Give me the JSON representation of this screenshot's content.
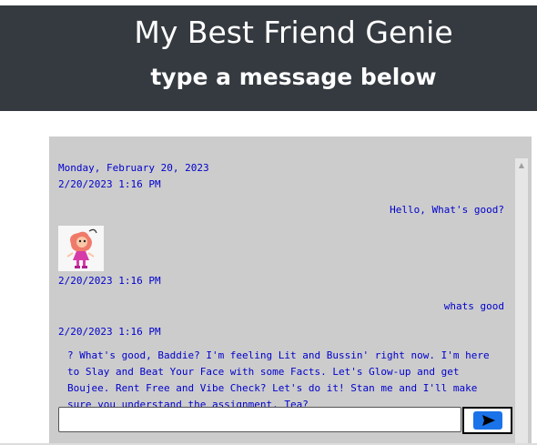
{
  "header": {
    "title": "My Best Friend Genie",
    "subtitle": "type a message below"
  },
  "chat": {
    "date_line": "Monday, February 20, 2023",
    "timestamp_1": "2/20/2023 1:16 PM",
    "user_message_1": "Hello, What's good?",
    "timestamp_2": "2/20/2023 1:16 PM",
    "user_message_2": "whats good",
    "timestamp_3": "2/20/2023 1:16 PM",
    "bot_reply": "? What's good, Baddie? I'm feeling Lit and Bussin' right now. I'm here to Slay and Beat Your Face with some Facts. Let's Glow-up and get Boujee. Rent Free and Vibe Check? Let's do it! Stan me and I'll make sure you understand the assignment. Tea?"
  },
  "input": {
    "value": "",
    "placeholder": ""
  },
  "icons": {
    "send": "send-arrow-icon",
    "avatar": "genie-avatar-icon",
    "scroll_up": "scroll-up-arrow-icon"
  },
  "colors": {
    "header_bg": "#343a40",
    "panel_bg": "#cccccc",
    "message_text": "#0000cc",
    "send_button": "#1a73e8"
  }
}
